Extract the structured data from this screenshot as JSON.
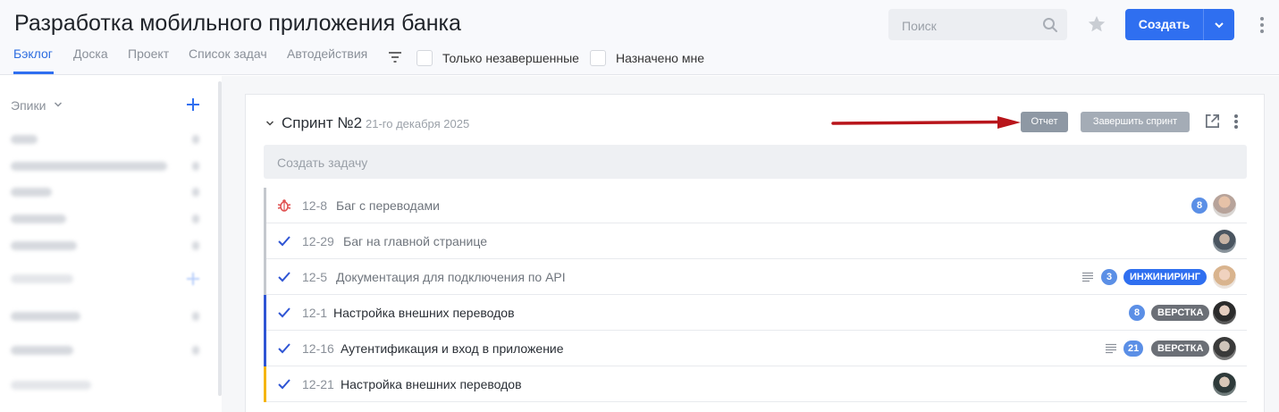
{
  "header": {
    "title": "Разработка мобильного приложения банка",
    "search_placeholder": "Поиск",
    "create_label": "Создать",
    "accent": "#2f6ff0"
  },
  "tabs": [
    {
      "label": "Бэклог",
      "active": true
    },
    {
      "label": "Доска"
    },
    {
      "label": "Проект"
    },
    {
      "label": "Список задач"
    },
    {
      "label": "Автодействия"
    }
  ],
  "filters": {
    "only_unfinished": "Только незавершенные",
    "assigned_to_me": "Назначено мне"
  },
  "sidebar": {
    "epics_label": "Эпики"
  },
  "sprint": {
    "name": "Спринт №2",
    "date": "21-го декабря 2025",
    "report_label": "Отчет",
    "finish_label": "Завершить спринт",
    "create_task_placeholder": "Создать задачу"
  },
  "tasks": [
    {
      "id": "12-8",
      "title": "Баг с переводами",
      "type_icon": "bug-icon",
      "stripe": "#c4c8ce",
      "count": "8"
    },
    {
      "id": "12-29",
      "title": "Баг на главной странице",
      "type_icon": "check-icon",
      "stripe": "#c4c8ce"
    },
    {
      "id": "12-5",
      "title": "Документация для подключения по API",
      "type_icon": "check-icon",
      "stripe": "#c4c8ce",
      "count": "3",
      "tag": "ИНЖИНИРИНГ",
      "tag_color": "#2f6ff0",
      "has_description": true
    },
    {
      "id": "12-1",
      "title": "Настройка внешних переводов",
      "type_icon": "check-icon",
      "stripe": "#2f55d4",
      "count": "8",
      "tag": "ВЕРСТКА",
      "tag_color": "#6b6f76"
    },
    {
      "id": "12-16",
      "title": "Аутентификация и вход в приложение",
      "type_icon": "check-icon",
      "stripe": "#2f55d4",
      "count": "21",
      "tag": "ВЕРСТКА",
      "tag_color": "#6b6f76",
      "has_description": true
    },
    {
      "id": "12-21",
      "title": "Настройка внешних переводов",
      "type_icon": "check-icon",
      "stripe": "#f5b50a"
    }
  ]
}
